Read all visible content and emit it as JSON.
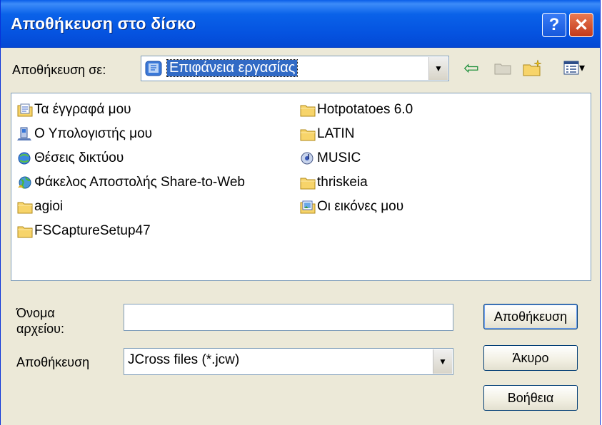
{
  "dialog": {
    "title": "Αποθήκευση στο δίσκο",
    "help_glyph": "?",
    "close_glyph": "✕"
  },
  "toolbar": {
    "save_in_label": "Αποθήκευση σε:",
    "save_in_value": "Επιφάνεια εργασίας",
    "dropdown_glyph": "▼",
    "back_glyph": "⇦",
    "view_menu_glyph": "▾"
  },
  "files": {
    "column1": [
      {
        "name": "Τα έγγραφά μου",
        "icon": "my-documents-icon"
      },
      {
        "name": "Ο Υπολογιστής μου",
        "icon": "my-computer-icon"
      },
      {
        "name": "Θέσεις δικτύου",
        "icon": "network-places-icon"
      },
      {
        "name": "Φάκελος Αποστολής Share-to-Web",
        "icon": "share-to-web-icon"
      },
      {
        "name": "agioi",
        "icon": "folder-icon"
      },
      {
        "name": "FSCaptureSetup47",
        "icon": "folder-icon"
      }
    ],
    "column2": [
      {
        "name": "Hotpotatoes 6.0",
        "icon": "folder-icon"
      },
      {
        "name": "LATIN",
        "icon": "folder-icon"
      },
      {
        "name": "MUSIC",
        "icon": "music-folder-icon"
      },
      {
        "name": "thriskeia",
        "icon": "folder-icon"
      },
      {
        "name": "Οι εικόνες μου",
        "icon": "my-pictures-icon"
      }
    ]
  },
  "form": {
    "filename_label_line1": "Όνομα",
    "filename_label_line2": "αρχείου:",
    "filename_value": "",
    "savetype_label": "Αποθήκευση",
    "savetype_value": "JCross files (*.jcw)"
  },
  "buttons": {
    "save": "Αποθήκευση",
    "cancel": "Άκυρο",
    "help": "Βοήθεια"
  },
  "colors": {
    "titlebar": "#0553e0",
    "selection": "#316ac5",
    "face": "#ece9d8"
  }
}
